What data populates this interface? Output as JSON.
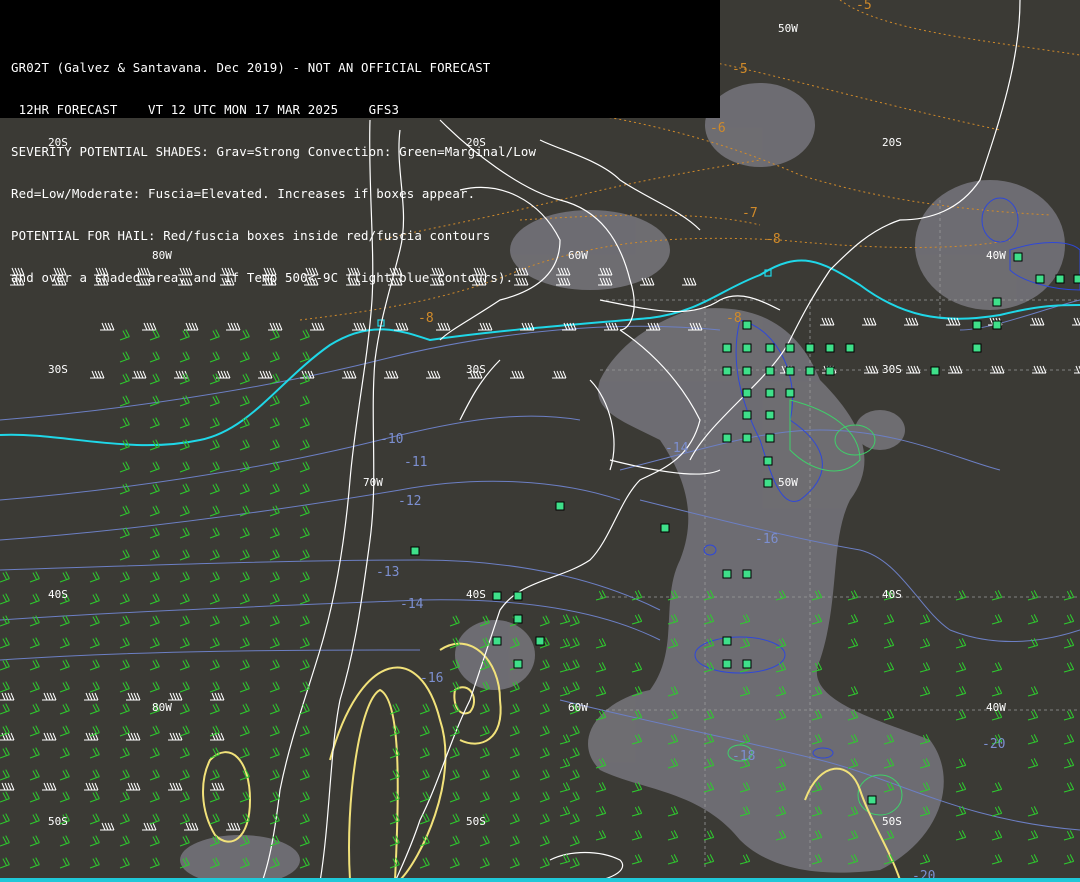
{
  "header": {
    "lines": [
      "GR02T (Galvez & Santavana. Dec 2019) - NOT AN OFFICIAL FORECAST",
      " 12HR FORECAST    VT 12 UTC MON 17 MAR 2025    GFS3",
      "SEVERITY POTENTIAL SHADES: Grav=Strong Convection: Green=Marginal/Low",
      "Red=Low/Moderate: Fuscia=Elevated. Increases if boxes appear.",
      "POTENTIAL FOR HAIL: Red/fuscia boxes inside red/fuscia contours",
      "and over a shaded area, and if Temp 500<-9C (light blue contours)."
    ]
  },
  "grid_labels": {
    "lat_20s": "20S",
    "lat_30s": "30S",
    "lat_40s": "40S",
    "lat_50s": "50S",
    "lon_80w": "80W",
    "lon_70w": "70W",
    "lon_60w": "60W",
    "lon_50w": "50W",
    "lon_40w": "40W"
  },
  "temp_labels": [
    "-10",
    "-11",
    "-12",
    "-13",
    "-14",
    "-14",
    "-16",
    "-16",
    "-20",
    "-20",
    "-18"
  ],
  "orange_labels": [
    "-5",
    "-5",
    "-6",
    "-7",
    "-8",
    "-8",
    "-8"
  ],
  "colors": {
    "background": "#3b3a35",
    "header_bg": "#000000",
    "land_outline": "#ffffff",
    "shade": "#7a7980",
    "freezing_line": "#1fd7e8",
    "temp_contour": "#7c8fd0",
    "orange_contour": "#d08a2a",
    "yellow_contour": "#f2e27a",
    "green_wind": "#2ecc2e",
    "white_wind": "#ffffff",
    "hail_box": "#3fe08a"
  }
}
